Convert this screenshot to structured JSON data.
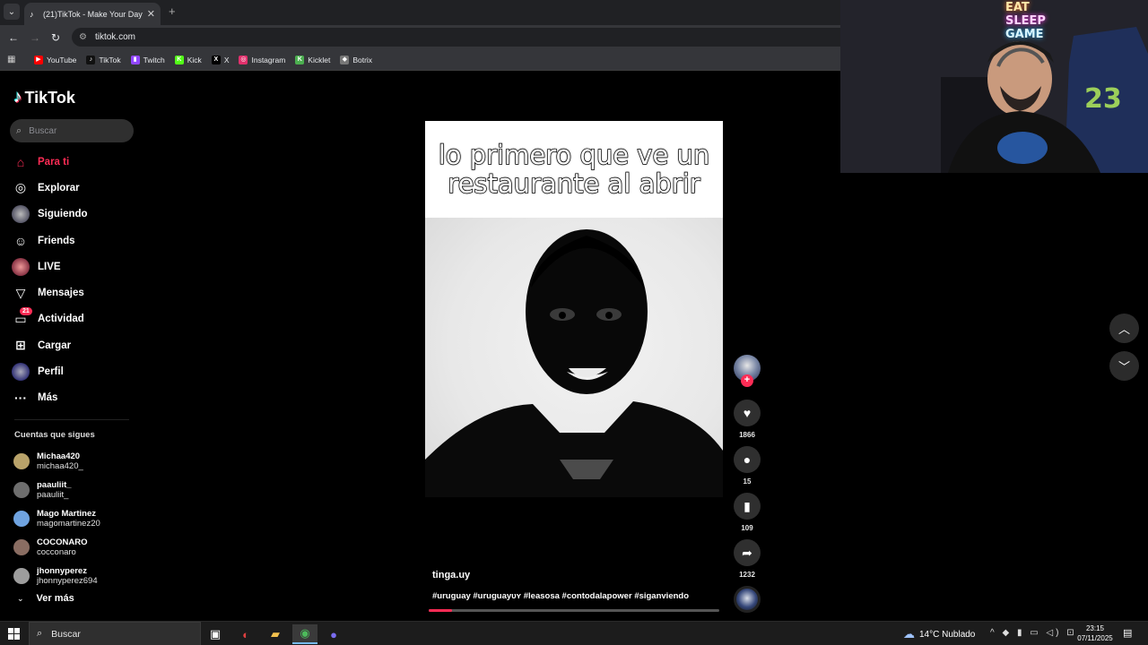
{
  "browser": {
    "tab_title": "(21)TikTok - Make Your Day",
    "tab_close": "✕",
    "new_tab": "+",
    "url": "tiktok.com",
    "bookmarks": [
      {
        "label": "YouTube",
        "icon": "youtube-icon",
        "color": "#ff0000",
        "glyph": "▶"
      },
      {
        "label": "TikTok",
        "icon": "tiktok-icon",
        "color": "#111111",
        "glyph": "♪"
      },
      {
        "label": "Twitch",
        "icon": "twitch-icon",
        "color": "#9146ff",
        "glyph": "▮"
      },
      {
        "label": "Kick",
        "icon": "kick-icon",
        "color": "#53fc18",
        "glyph": "K"
      },
      {
        "label": "X",
        "icon": "x-icon",
        "color": "#000000",
        "glyph": "X"
      },
      {
        "label": "Instagram",
        "icon": "instagram-icon",
        "color": "#e1306c",
        "glyph": "◎"
      },
      {
        "label": "Kicklet",
        "icon": "kicklet-icon",
        "color": "#4caf50",
        "glyph": "K"
      },
      {
        "label": "Botrix",
        "icon": "botrix-icon",
        "color": "#777777",
        "glyph": "◆"
      }
    ]
  },
  "sidebar": {
    "logo": "TikTok",
    "search_placeholder": "Buscar",
    "items": [
      {
        "label": "Para ti",
        "icon": "home-icon",
        "glyph": "⌂",
        "active": true
      },
      {
        "label": "Explorar",
        "icon": "compass-icon",
        "glyph": "◎"
      },
      {
        "label": "Siguiendo",
        "icon": "following-avatar-icon",
        "glyph": ""
      },
      {
        "label": "Friends",
        "icon": "friends-icon",
        "glyph": "☺"
      },
      {
        "label": "LIVE",
        "icon": "live-avatar-icon",
        "glyph": ""
      },
      {
        "label": "Mensajes",
        "icon": "messages-icon",
        "glyph": "▽"
      },
      {
        "label": "Actividad",
        "icon": "activity-icon",
        "glyph": "▭",
        "badge": "21"
      },
      {
        "label": "Cargar",
        "icon": "upload-icon",
        "glyph": "⊞"
      },
      {
        "label": "Perfil",
        "icon": "profile-avatar-icon",
        "glyph": ""
      },
      {
        "label": "Más",
        "icon": "more-icon",
        "glyph": "···"
      }
    ],
    "following_title": "Cuentas que sigues",
    "accounts": [
      {
        "name": "Michaa420",
        "handle": "michaa420_",
        "color": "#b9a36a"
      },
      {
        "name": "paauliit_",
        "handle": "paauliit_",
        "color": "#6e6e6e"
      },
      {
        "name": "Mago Martinez",
        "handle": "magomartinez20",
        "color": "#6fa3e0"
      },
      {
        "name": "COCONARO",
        "handle": "cocconaro",
        "color": "#8a6d62"
      },
      {
        "name": "jhonnyperez",
        "handle": "jhonnyperez694",
        "color": "#9d9d9d"
      }
    ],
    "see_more": "Ver más"
  },
  "video": {
    "caption": "lo primero que ve un restaurante al abrir",
    "author": "tinga.uy",
    "tags": "#uruguay #uruguayᴜʏ #leasosa #contodalapower #siganviendo",
    "progress": 0.08
  },
  "actions": {
    "likes": "1866",
    "comments": "15",
    "saves": "109",
    "shares": "1232"
  },
  "webcam": {
    "neon_line1": "EAT",
    "neon_line2": "SLEEP",
    "neon_line3": "GAME"
  },
  "taskbar": {
    "search_placeholder": "Buscar",
    "weather": "14°C  Nublado",
    "time": "23:15",
    "date": "07/11/2025"
  },
  "colors": {
    "accent": "#fe2c55",
    "chrome_bg": "#35363a"
  }
}
